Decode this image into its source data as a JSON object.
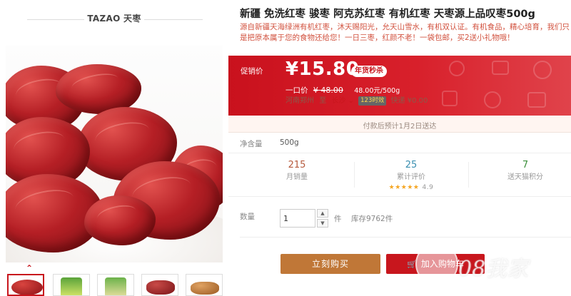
{
  "brand": {
    "name": "TAZAO 天枣"
  },
  "gallery": {
    "prev_arrow": "⌃",
    "thumbnails": [
      "thumb-1",
      "thumb-2",
      "thumb-3",
      "thumb-4",
      "thumb-5"
    ]
  },
  "product": {
    "title": "新疆 免洗红枣 骏枣 阿克苏红枣 有机红枣 天枣源上品叹枣500g",
    "description": "源自新疆天海绿洲有机红枣，沐天赐阳光，允天山雪水，有机双认证。有机食品，精心培育，我们只是把原本属于您的食物还给您！一日三枣，红颜不老！一袋包邮，买2送小礼物哦！"
  },
  "price_panel": {
    "label": "促销价",
    "price": "¥15.80",
    "badge": "年货秒杀",
    "original_label": "一口价",
    "original_price": "¥ 48.00",
    "unit_price": "48.00元/500g"
  },
  "shipping": {
    "from": "河南郑州",
    "to_word": "至",
    "destination": "长沙",
    "chip": "123时效",
    "courier": "快递",
    "fee": "¥0.00",
    "delivery_note": "付款后预计1月2日送达"
  },
  "net": {
    "label": "净含量",
    "value": "500g"
  },
  "stats": {
    "monthly_sales": {
      "value": "215",
      "label": "月销量"
    },
    "reviews": {
      "value": "25",
      "label": "累计评价",
      "stars": "★★★★★",
      "score": "4.9"
    },
    "points": {
      "value": "7",
      "label": "送天猫积分"
    }
  },
  "quantity": {
    "label": "数量",
    "value": "1",
    "unit": "件",
    "stock": "库存9762件"
  },
  "buttons": {
    "buy_now": "立刻购买",
    "add_to_cart": "加入购物车"
  },
  "watermark": {
    "text": "08我家"
  },
  "colors": {
    "accent_red": "#c8161d",
    "buy_orange": "#c07737",
    "price_bg": "#d8202b"
  }
}
